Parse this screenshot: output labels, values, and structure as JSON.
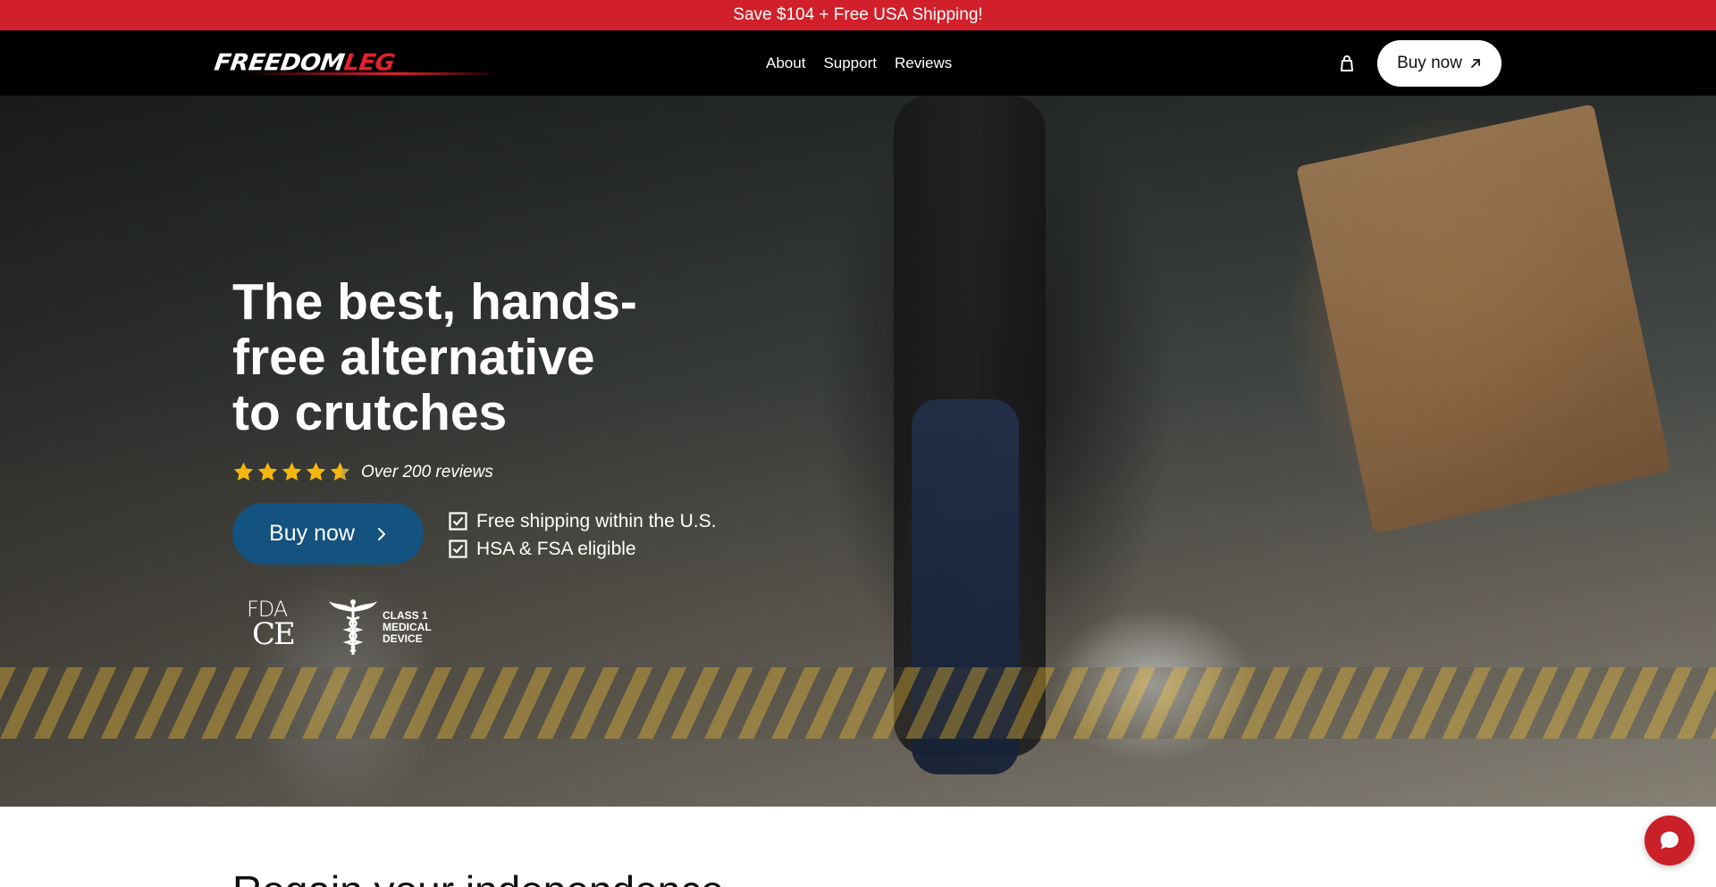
{
  "announcement": {
    "text": "Save $104 + Free USA Shipping!"
  },
  "header": {
    "logo": {
      "part1": "FREEDOM",
      "part2": "LEG"
    },
    "nav": [
      {
        "label": "About"
      },
      {
        "label": "Support"
      },
      {
        "label": "Reviews"
      }
    ],
    "cart_icon": "shopping-bag-icon",
    "buy_label": "Buy now",
    "buy_icon": "arrow-up-right-icon"
  },
  "hero": {
    "title": "The best, hands-free alternative to crutches",
    "rating": {
      "stars": 4.5,
      "max": 5,
      "text": "Over 200 reviews"
    },
    "buy_label": "Buy now",
    "features": [
      {
        "text": "Free shipping within the U.S."
      },
      {
        "text": "HSA & FSA eligible"
      }
    ],
    "certifications": {
      "fda": "FDA",
      "ce": "CE",
      "class1": [
        "CLASS 1",
        "MEDICAL",
        "DEVICE"
      ]
    }
  },
  "next_section": {
    "heading": "Regain your independence"
  },
  "colors": {
    "announcement_bg": "#d1202b",
    "nav_bg": "#000000",
    "hero_button": "#14527f",
    "star": "#f5b70d",
    "chat_button": "#c9202a"
  },
  "chat": {
    "icon": "chat-bubble-icon"
  }
}
